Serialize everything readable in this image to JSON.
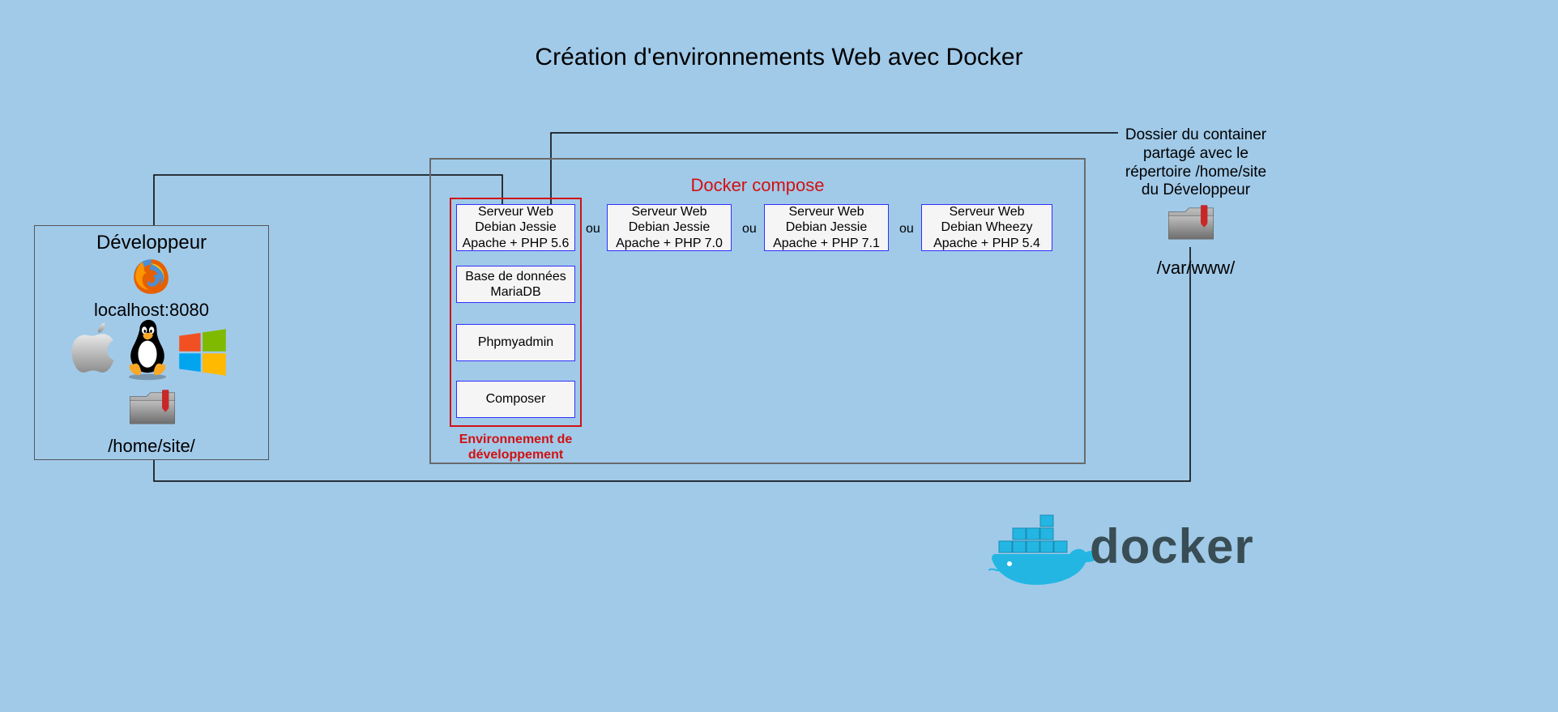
{
  "title": "Création d'environnements Web avec Docker",
  "developer": {
    "heading": "Développeur",
    "localhost": "localhost:8080",
    "folder": "/home/site/"
  },
  "compose": {
    "title": "Docker compose",
    "env_caption_l1": "Environnement de",
    "env_caption_l2": "développement"
  },
  "services": {
    "php56_l1": "Serveur Web",
    "php56_l2": "Debian Jessie",
    "php56_l3": "Apache + PHP 5.6",
    "php70_l1": "Serveur Web",
    "php70_l2": "Debian Jessie",
    "php70_l3": "Apache + PHP 7.0",
    "php71_l1": "Serveur Web",
    "php71_l2": "Debian Jessie",
    "php71_l3": "Apache + PHP 7.1",
    "php54_l1": "Serveur Web",
    "php54_l2": "Debian Wheezy",
    "php54_l3": "Apache + PHP 5.4",
    "or": "ou",
    "mariadb_l1": "Base de données",
    "mariadb_l2": "MariaDB",
    "phpmyadmin": "Phpmyadmin",
    "composer": "Composer"
  },
  "share": {
    "l1": "Dossier du container",
    "l2": "partagé avec le",
    "l3": "répertoire /home/site",
    "l4": "du Développeur",
    "path": "/var/www/"
  },
  "docker_brand": "docker"
}
